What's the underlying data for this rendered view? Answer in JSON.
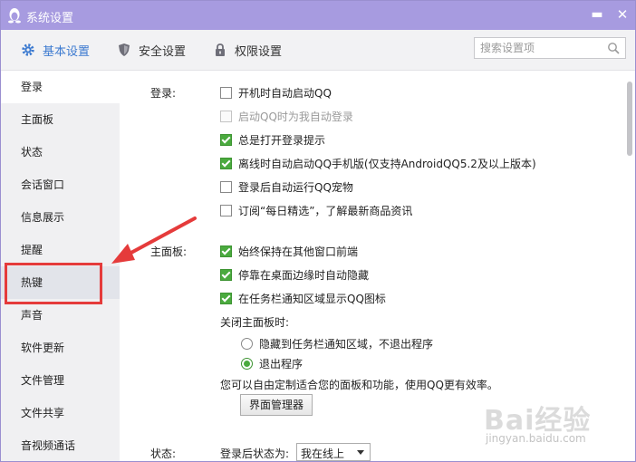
{
  "window": {
    "title": "系统设置",
    "minimize_glyph": "▬",
    "close_glyph": "✕"
  },
  "tabs": [
    {
      "label": "基本设置",
      "icon": "gear-icon",
      "active": true
    },
    {
      "label": "安全设置",
      "icon": "shield-icon",
      "active": false
    },
    {
      "label": "权限设置",
      "icon": "lock-icon",
      "active": false
    }
  ],
  "search": {
    "placeholder": "搜索设置项",
    "value": ""
  },
  "sidebar": {
    "items": [
      {
        "label": "登录",
        "state": "selected"
      },
      {
        "label": "主面板",
        "state": "normal"
      },
      {
        "label": "状态",
        "state": "normal"
      },
      {
        "label": "会话窗口",
        "state": "normal"
      },
      {
        "label": "信息展示",
        "state": "normal"
      },
      {
        "label": "提醒",
        "state": "normal"
      },
      {
        "label": "热键",
        "state": "hover"
      },
      {
        "label": "声音",
        "state": "normal"
      },
      {
        "label": "软件更新",
        "state": "normal"
      },
      {
        "label": "文件管理",
        "state": "normal"
      },
      {
        "label": "文件共享",
        "state": "normal"
      },
      {
        "label": "音视频通话",
        "state": "normal"
      }
    ]
  },
  "login": {
    "section_label": "登录:",
    "options": [
      {
        "label": "开机时自动启动QQ",
        "checked": false,
        "disabled": false
      },
      {
        "label": "启动QQ时为我自动登录",
        "checked": false,
        "disabled": true
      },
      {
        "label": "总是打开登录提示",
        "checked": true,
        "disabled": false
      },
      {
        "label": "离线时自动启动QQ手机版(仅支持AndroidQQ5.2及以上版本)",
        "checked": true,
        "disabled": false
      },
      {
        "label": "登录后自动运行QQ宠物",
        "checked": false,
        "disabled": false
      },
      {
        "label": "订阅“每日精选”，了解最新商品资讯",
        "checked": false,
        "disabled": false
      }
    ]
  },
  "main_panel": {
    "section_label": "主面板:",
    "options": [
      {
        "label": "始终保持在其他窗口前端",
        "checked": true
      },
      {
        "label": "停靠在桌面边缘时自动隐藏",
        "checked": true
      },
      {
        "label": "在任务栏通知区域显示QQ图标",
        "checked": true
      }
    ],
    "close_label": "关闭主面板时:",
    "close_options": [
      {
        "label": "隐藏到任务栏通知区域，不退出程序",
        "selected": false
      },
      {
        "label": "退出程序",
        "selected": true
      }
    ],
    "note": "您可以自由定制适合您的面板和功能，使用QQ更有效率。",
    "manager_button": "界面管理器"
  },
  "status": {
    "section_label": "状态:",
    "after_login_label": "登录后状态为:",
    "after_login_value": "我在线上"
  },
  "watermark": {
    "text": "Bai经验",
    "sub": "jingyan.baidu.com"
  },
  "colors": {
    "titlebar": "#a79be0",
    "active_tab": "#3c7ad0",
    "checkbox_checked": "#4aaa3e",
    "highlight_box": "#e53b3b"
  }
}
